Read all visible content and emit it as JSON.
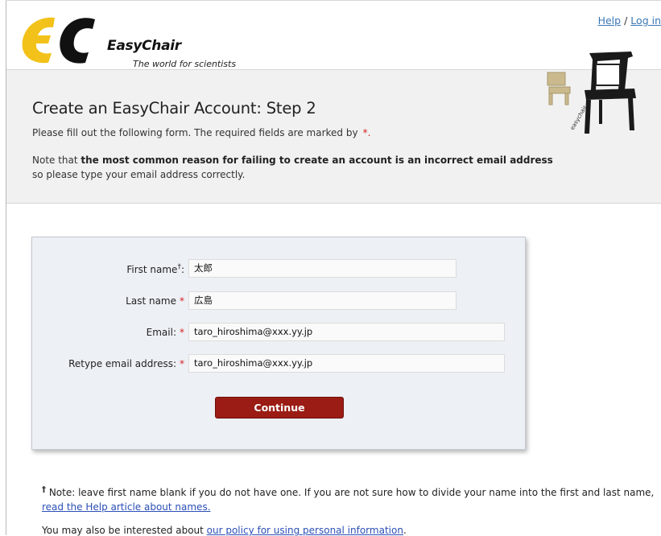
{
  "header": {
    "logo_name": "EasyChair",
    "logo_tagline": "The world for scientists",
    "help_link": "Help",
    "separator": "/",
    "login_link": "Log in"
  },
  "page": {
    "title": "Create an EasyChair Account: Step 2",
    "intro_text": "Please fill out the following form. The required fields are marked by",
    "required_marker": "*.",
    "note_prefix": "Note that ",
    "note_bold": "the most common reason for failing to create an account is an incorrect email address",
    "note_suffix": " so please type your email address correctly."
  },
  "form": {
    "first_name": {
      "label": "First name",
      "dagger": "†",
      "colon": ":",
      "value": "太郎"
    },
    "last_name": {
      "label": "Last name",
      "star": "*",
      "value": "広島"
    },
    "email": {
      "label": "Email:",
      "star": "*",
      "value": "taro_hiroshima@xxx.yy.jp"
    },
    "retype_email": {
      "label": "Retype email address:",
      "star": "*",
      "value": "taro_hiroshima@xxx.yy.jp"
    },
    "continue_label": "Continue"
  },
  "footer": {
    "dagger": "†",
    "note_text": " Note: leave first name blank if you do not have one. If you are not sure how to divide your name into the first and last name, ",
    "names_link": "read the Help article about names.",
    "policy_prefix": "You may also be interested about ",
    "policy_link": "our policy for using personal information",
    "policy_suffix": "."
  },
  "colors": {
    "button": "#9b1c14",
    "required": "#d71f1f",
    "link": "#2b4fb6",
    "band": "#f1f1f1",
    "panel": "#edf0f5"
  }
}
